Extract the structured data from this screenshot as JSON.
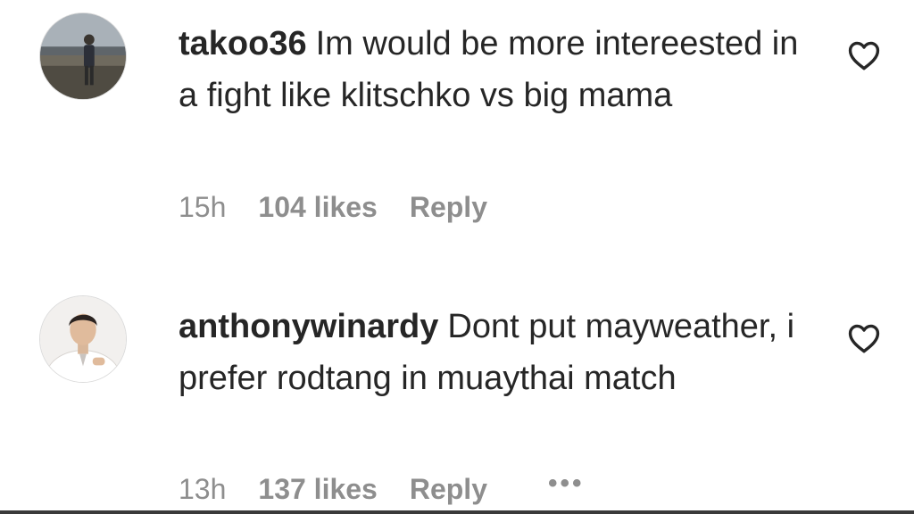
{
  "comments": [
    {
      "username": "takoo36",
      "text": "Im would be more intereested in a fight like klitschko vs big mama",
      "time": "15h",
      "likes": "104 likes",
      "reply": "Reply",
      "avatar_icon": "user-photo-outdoor",
      "heart_icon": "heart-outline-icon"
    },
    {
      "username": "anthonywinardy",
      "text": "Dont put mayweather, i prefer rodtang in muaythai match",
      "time": "13h",
      "likes": "137 likes",
      "reply": "Reply",
      "more": "•••",
      "avatar_icon": "user-photo-portrait",
      "heart_icon": "heart-outline-icon"
    }
  ],
  "colors": {
    "text_primary": "#262626",
    "text_secondary": "#8e8e8e",
    "background": "#ffffff"
  }
}
